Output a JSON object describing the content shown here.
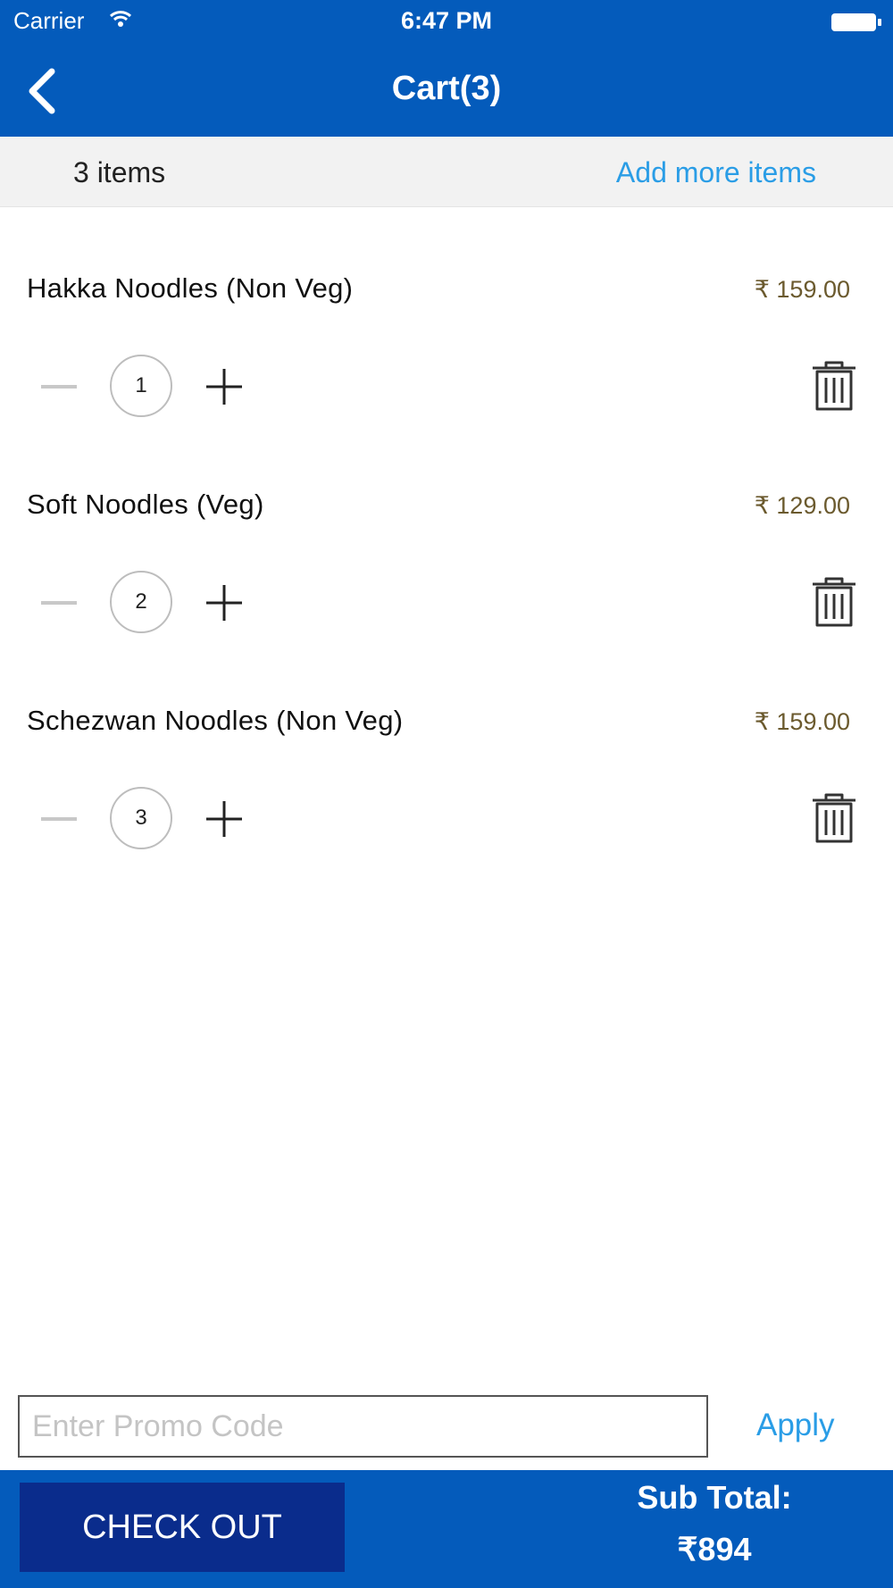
{
  "status_bar": {
    "carrier": "Carrier",
    "time": "6:47 PM"
  },
  "nav": {
    "title": "Cart(3)"
  },
  "summary": {
    "items_count": "3  items",
    "add_more": "Add more items"
  },
  "cart": {
    "items": [
      {
        "name": "Hakka Noodles (Non Veg)",
        "price": "₹ 159.00",
        "quantity": "1"
      },
      {
        "name": "Soft Noodles (Veg)",
        "price": "₹ 129.00",
        "quantity": "2"
      },
      {
        "name": "Schezwan Noodles (Non Veg)",
        "price": "₹ 159.00",
        "quantity": "3"
      }
    ]
  },
  "promo": {
    "placeholder": "Enter Promo Code",
    "apply_label": "Apply"
  },
  "footer": {
    "checkout_label": "CHECK OUT",
    "subtotal_label": "Sub Total:",
    "subtotal_value": "₹894"
  },
  "colors": {
    "primary": "#045bbb",
    "checkout": "#0a2c8c",
    "link": "#2a9de6",
    "price": "#6b5a2e"
  },
  "icons": [
    "wifi-icon",
    "battery-icon",
    "back-chevron-icon",
    "minus-icon",
    "plus-icon",
    "trash-icon"
  ]
}
